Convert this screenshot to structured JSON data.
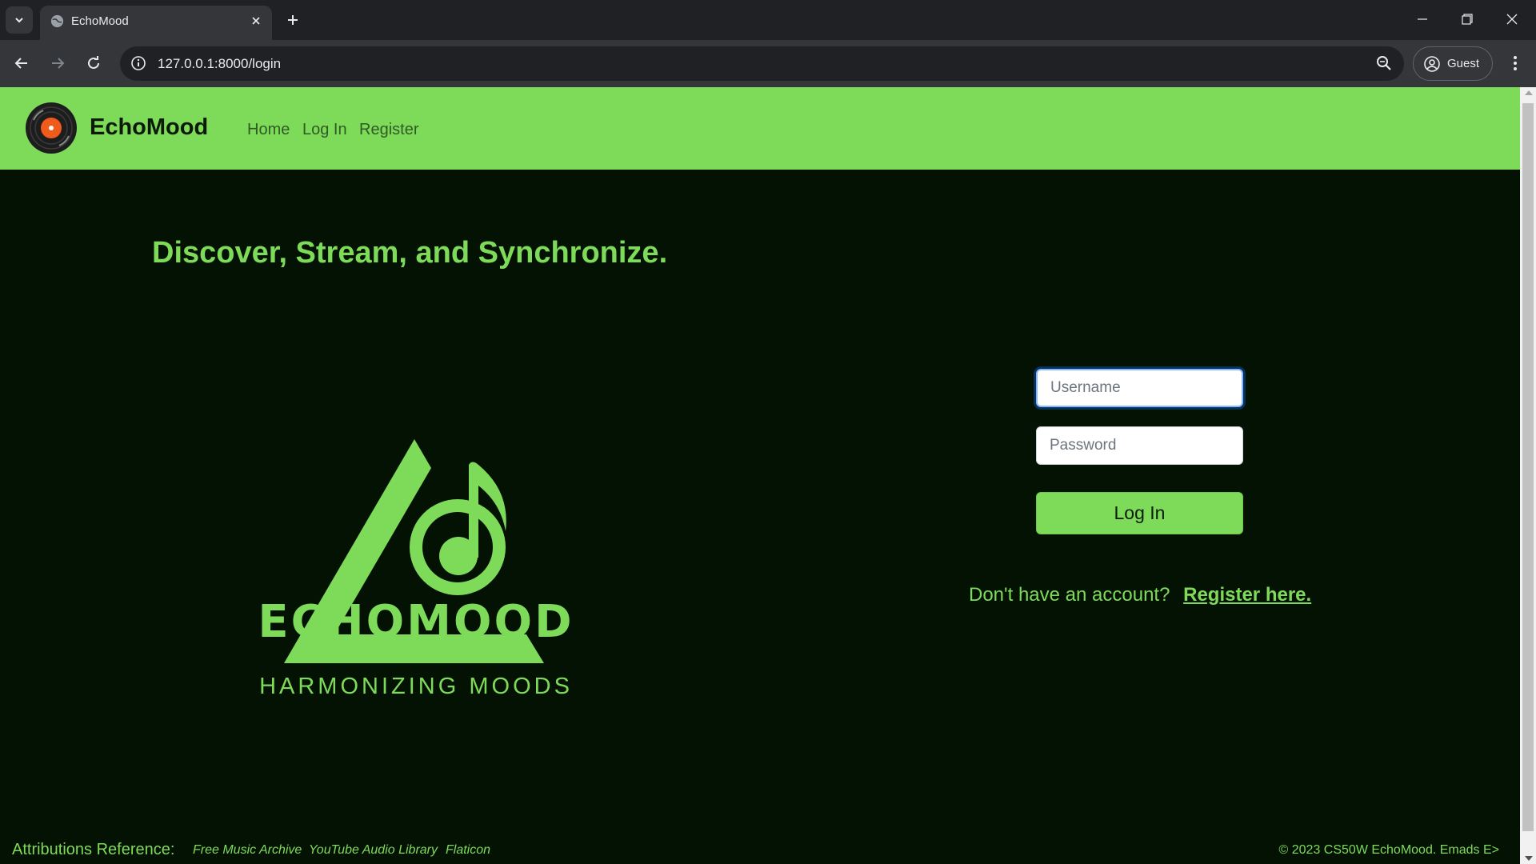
{
  "browser": {
    "tab_title": "EchoMood",
    "url": "127.0.0.1:8000/login",
    "profile_label": "Guest"
  },
  "navbar": {
    "brand": "EchoMood",
    "links": [
      "Home",
      "Log In",
      "Register"
    ]
  },
  "hero": {
    "headline": "Discover, Stream, and Synchronize.",
    "logo_word": "ECHOMOOD",
    "logo_tagline": "HARMONIZING MOODS"
  },
  "login_form": {
    "username_placeholder": "Username",
    "password_placeholder": "Password",
    "submit_label": "Log In",
    "register_prompt": "Don't have an account?",
    "register_link": "Register here."
  },
  "footer": {
    "attributions_label": "Attributions Reference:",
    "attribution_links": [
      "Free Music Archive",
      "YouTube Audio Library",
      "Flaticon"
    ],
    "copyright": "© 2023 CS50W EchoMood. Emads  E>"
  },
  "colors": {
    "accent_green": "#7edb5a",
    "page_background": "#031202",
    "chrome_dark": "#202124"
  }
}
